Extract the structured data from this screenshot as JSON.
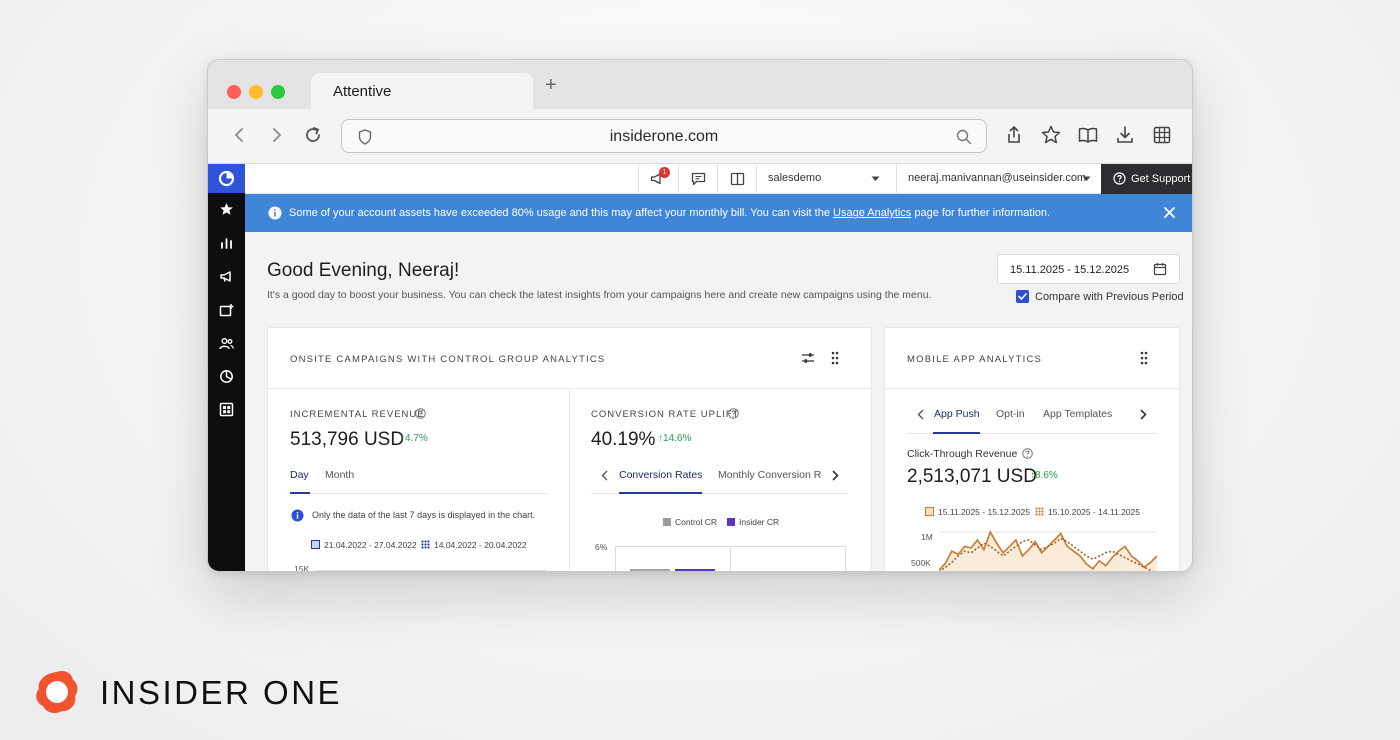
{
  "browser": {
    "tab_title": "Attentive",
    "new_tab": "+",
    "url": "insiderone.com"
  },
  "topbar": {
    "notification_count": "1",
    "account": "salesdemo",
    "user_email": "neeraj.manivannan@useinsider.com",
    "support_label": "Get Support"
  },
  "banner": {
    "text_before": "Some of your account assets have exceeded 80% usage and this may affect your monthly bill. You can visit the ",
    "link": "Usage Analytics",
    "text_after": " page for further information."
  },
  "header": {
    "greeting": "Good Evening, Neeraj!",
    "subtitle": "It's a good day to boost your business. You can check the latest insights from your campaigns here and create new campaigns using the menu.",
    "date_range": "15.11.2025 - 15.12.2025",
    "compare_label": "Compare with Previous Period"
  },
  "onsite_card": {
    "title": "ONSITE CAMPAIGNS WITH CONTROL GROUP ANALYTICS",
    "revenue": {
      "label": "INCREMENTAL REVENUE",
      "value": "513,796 USD",
      "delta": "4.7%",
      "tabs": [
        "Day",
        "Month"
      ],
      "info": "Only the data of the last 7 days is displayed in the chart.",
      "legend": [
        "21.04.2022 - 27.04.2022",
        "14.04.2022 - 20.04.2022"
      ],
      "axis_top": "15K"
    },
    "conversion": {
      "label": "CONVERSION RATE UPLIFT",
      "value": "40.19%",
      "delta": "14.6%",
      "tabs": [
        "Conversion Rates",
        "Monthly Conversion R"
      ],
      "legend": [
        "Control CR",
        "Insider CR"
      ],
      "axis_top": "6%"
    }
  },
  "mobile_card": {
    "title": "MOBILE APP ANALYTICS",
    "tabs": [
      "App Push",
      "Opt-in",
      "App Templates"
    ],
    "metric_label": "Click-Through Revenue",
    "value": "2,513,071 USD",
    "delta": "8.6%",
    "legend": [
      "15.11.2025 - 15.12.2025",
      "15.10.2025 - 14.11.2025"
    ],
    "axis": [
      "1M",
      "500K"
    ],
    "series_current": [
      520,
      610,
      760,
      720,
      820,
      800,
      900,
      780,
      1000,
      860,
      740,
      820,
      900,
      700,
      780,
      880,
      740,
      820,
      900,
      980,
      820,
      760,
      700,
      600,
      540,
      640,
      580,
      680,
      760,
      820,
      700,
      640,
      560,
      620,
      700
    ],
    "series_previous": [
      500,
      560,
      620,
      700,
      760,
      740,
      800,
      860,
      820,
      760,
      700,
      760,
      820,
      880,
      900,
      840,
      780,
      820,
      860,
      920,
      880,
      820,
      760,
      700,
      660,
      700,
      740,
      760,
      720,
      680,
      640,
      600,
      560,
      520,
      480
    ]
  },
  "brand": {
    "name": "INSIDER ONE"
  },
  "colors": {
    "accent": "#2c4fd6",
    "banner": "#3f86d8",
    "positive": "#27a04a",
    "chart_orange": "#c9782e"
  }
}
